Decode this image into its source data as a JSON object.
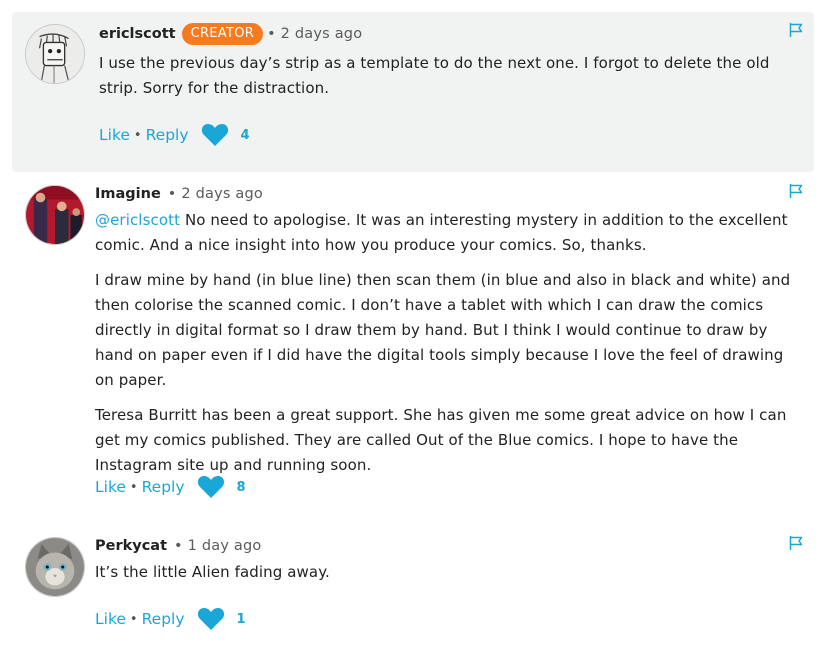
{
  "comments": [
    {
      "username": "ericlscott",
      "badge": "CREATOR",
      "time": "• 2 days ago",
      "paragraphs": [
        "I use the previous day’s strip as a template to do the next one. I forgot to delete the old strip. Sorry for the distraction."
      ],
      "like_label": "Like",
      "separator": "•",
      "reply_label": "Reply",
      "like_count": "4"
    },
    {
      "username": "Imagine",
      "time": "• 2 days ago",
      "mention": "@ericlscott",
      "paragraphs": [
        " No need to apologise. It was an interesting mystery in addition to the excellent comic. And a nice insight into how you produce your comics. So, thanks.",
        "I draw mine by hand (in blue line) then scan them (in blue and also in black and white) and then colorise the scanned comic. I don’t have a tablet with which I can draw the comics directly in digital format so I draw them by hand. But I think I would continue to draw by hand on paper even if I did have the digital tools simply because I love the feel of drawing on paper.",
        "Teresa Burritt has been a great support. She has given me some great advice on how I can get my comics published. They are called Out of the Blue comics. I hope to have the Instagram site up and running soon."
      ],
      "like_label": "Like",
      "separator": "•",
      "reply_label": "Reply",
      "like_count": "8"
    },
    {
      "username": "Perkycat",
      "time": "• 1 day ago",
      "paragraphs": [
        "It’s the little Alien fading away."
      ],
      "like_label": "Like",
      "separator": "•",
      "reply_label": "Reply",
      "like_count": "1"
    }
  ],
  "colors": {
    "accent": "#1ba6d8",
    "creator_badge": "#f47b20",
    "creator_background": "#f1f2f2"
  },
  "icons": {
    "flag": "flag-icon",
    "like": "heart-icon"
  }
}
